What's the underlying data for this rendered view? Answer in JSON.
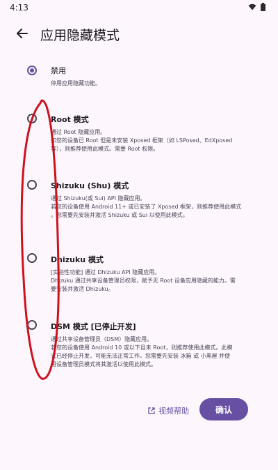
{
  "status_bar": {
    "time": "4:13",
    "wifi_icon": "wifi-icon",
    "battery_icon": "battery-icon"
  },
  "app_bar": {
    "title": "应用隐藏模式",
    "back_icon": "arrow-left-icon"
  },
  "options": [
    {
      "title": "禁用",
      "desc": [
        "停用应用隐藏功能。"
      ],
      "checked": true
    },
    {
      "title": "Root 模式",
      "desc": [
        "通过 Root 隐藏应用。",
        "如您的设备已 Root 但是未安装 Xposed 框架（如 LSPosed、EdXposed",
        "等），则推荐使用此模式。需要 Root 权限。"
      ],
      "checked": false
    },
    {
      "title": "Shizuku (Shu) 模式",
      "desc": [
        "通过 Shizuku(或 Sui) API 隐藏应用。",
        "若您的设备使用 Android 11+ 或已安装了 Xposed 框架，则推荐使用此模式",
        "。您需要先安装并激活 Shizuku 或 Sui 以使用此模式。"
      ],
      "checked": false
    },
    {
      "title": "Dhizuku 模式",
      "desc": [
        "[实验性功能] 通过 Dhizuku API 隐藏应用。",
        "Dhizuku 通过共享设备管理员权限，赋予无 Root 设备应用隐藏的能力。需",
        "要安装并激活 Dhizuku。"
      ],
      "checked": false
    },
    {
      "title": "DSM 模式 [已停止开发]",
      "desc": [
        "通过共享设备管理员（DSM）隐藏应用。",
        "若您的设备使用 Android 10 或以下且未 Root，则推荐使用此模式。此模",
        "式已经停止开发，可能无法正常工作。您需要先安装 冰箱 或 小黑屋 并使",
        "用设备管理员模式将其激活以使用此模式。"
      ],
      "checked": false
    }
  ],
  "footer": {
    "help_label": "视频帮助",
    "help_icon": "external-link-icon",
    "confirm_label": "确认"
  },
  "colors": {
    "accent": "#6750a4",
    "annotation": "#d0101e",
    "background": "#fdf7fd"
  }
}
